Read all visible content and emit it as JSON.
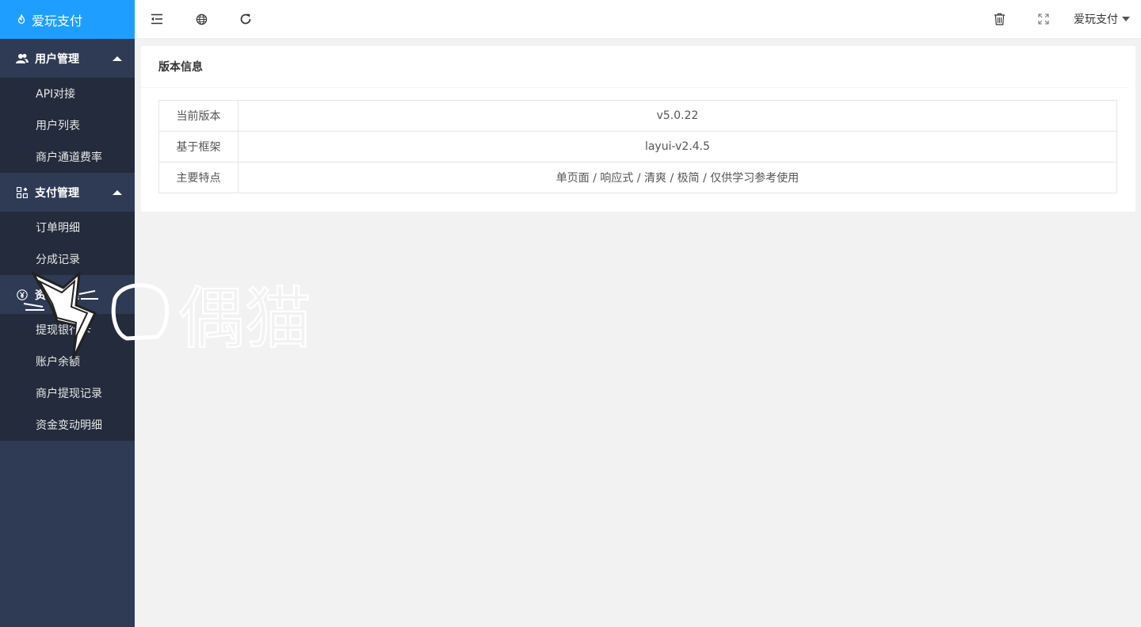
{
  "app": {
    "title": "爱玩支付"
  },
  "sidebar": {
    "groups": [
      {
        "label": "用户管理",
        "icon": "users-icon",
        "items": [
          "API对接",
          "用户列表",
          "商户通道费率"
        ]
      },
      {
        "label": "支付管理",
        "icon": "apps-icon",
        "items": [
          "订单明细",
          "分成记录"
        ]
      },
      {
        "label": "资金管理",
        "icon": "yen-icon",
        "items": [
          "提现银行卡",
          "账户余额",
          "商户提现记录",
          "资金变动明细"
        ]
      }
    ]
  },
  "header": {
    "user_label": "爱玩支付",
    "icons": [
      "menu-collapse-icon",
      "globe-icon",
      "refresh-icon",
      "trash-icon",
      "fullscreen-icon"
    ]
  },
  "version_card": {
    "title": "版本信息",
    "rows": [
      {
        "key": "当前版本",
        "value": "v5.0.22"
      },
      {
        "key": "基于框架",
        "value": "layui-v2.4.5"
      },
      {
        "key": "主要特点",
        "value": "单页面 / 响应式 / 清爽 / 极简 / 仅供学习参考使用"
      }
    ]
  },
  "watermark": {
    "text": "偶猫"
  },
  "colors": {
    "logo_bg": "#1e9fff",
    "sidebar_bg": "#2f3b55",
    "submenu_bg": "#232b3c"
  }
}
